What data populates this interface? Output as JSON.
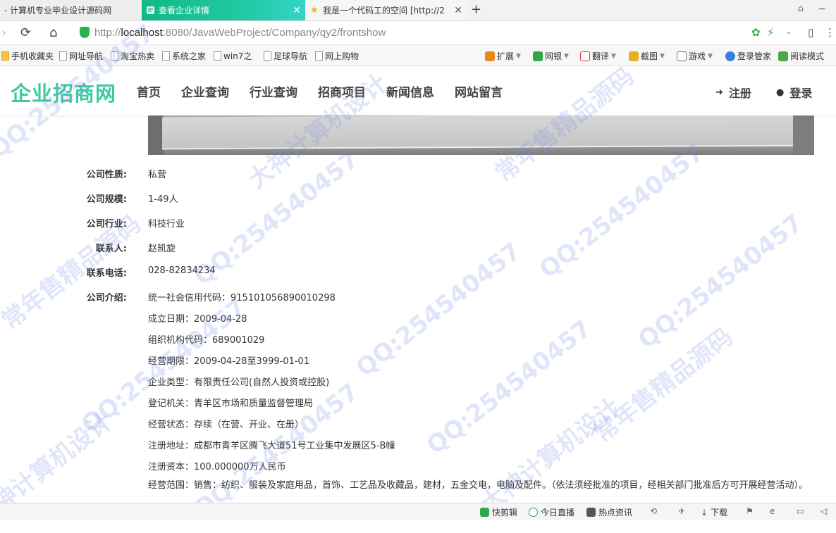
{
  "browser": {
    "tabs": [
      {
        "title": "- 计算机专业毕业设计源码网",
        "active": false
      },
      {
        "title": "查看企业详情",
        "active": true
      },
      {
        "title": "我是一个代码工的空间 [http://2",
        "active": false
      }
    ],
    "new_tab_symbol": "+",
    "url_prefix": "http://",
    "url_host": "localhost",
    "url_rest": ":8080/JavaWebProject/Company/qy2/frontshow",
    "bookmarks": [
      "手机收藏夹",
      "网址导航",
      "淘宝热卖",
      "系统之家",
      "win7之",
      "足球导航",
      "网上购物"
    ],
    "toolbar_items": [
      "扩展",
      "网银",
      "翻译",
      "截图",
      "游戏",
      "登录管家",
      "阅读模式"
    ]
  },
  "site": {
    "logo": "企业招商网",
    "nav": [
      "首页",
      "企业查询",
      "行业查询",
      "招商项目",
      "新闻信息",
      "网站留言"
    ],
    "register": "注册",
    "login": "登录"
  },
  "company": {
    "fields": [
      {
        "label": "公司性质:",
        "value": "私营"
      },
      {
        "label": "公司规模:",
        "value": "1-49人"
      },
      {
        "label": "公司行业:",
        "value": "科技行业"
      },
      {
        "label": "联系人:",
        "value": "赵凯旋"
      },
      {
        "label": "联系电话:",
        "value": "028-82834234"
      }
    ],
    "intro_label": "公司介绍:",
    "intro_lines": [
      "统一社会信用代码：915101056890010298",
      "成立日期：2009-04-28",
      "组织机构代码：689001029",
      "经营期限：2009-04-28至3999-01-01",
      "企业类型：有限责任公司(自然人投资或控股)",
      "登记机关：青羊区市场和质量监督管理局",
      "经营状态：存续（在营、开业、在册）",
      "注册地址：成都市青羊区腾飞大道51号工业集中发展区5-B幢",
      "注册资本：100.000000万人民币"
    ],
    "intro_scope": "经营范围：销售：纺织、服装及家庭用品，首饰、工艺品及收藏品，建材，五金交电，电脑及配件。（依法须经批准的项目，经相关部门批准后方可开展经营活动）。"
  },
  "statusbar": [
    "快剪辑",
    "今日直播",
    "热点资讯",
    "下载"
  ],
  "watermarks": [
    "QQ:254540457",
    "大神计算机设计",
    "常年售精品源码"
  ],
  "colors": {
    "accent": "#3fc9a2",
    "active_tab": "#20c9a0"
  }
}
